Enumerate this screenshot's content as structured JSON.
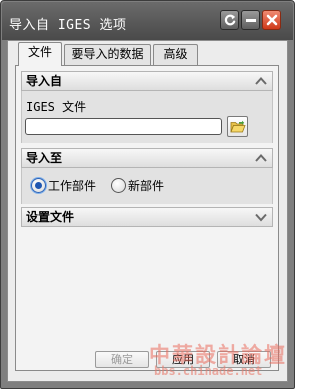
{
  "window": {
    "title": "导入自 IGES 选项"
  },
  "tabs": [
    {
      "label": "文件",
      "active": true
    },
    {
      "label": "要导入的数据",
      "active": false
    },
    {
      "label": "高级",
      "active": false
    }
  ],
  "import_from": {
    "header": "导入自",
    "field_label": "IGES 文件",
    "file_value": "",
    "placeholder": ""
  },
  "import_to": {
    "header": "导入至",
    "options": [
      {
        "label": "工作部件",
        "checked": true
      },
      {
        "label": "新部件",
        "checked": false
      }
    ]
  },
  "settings_file": {
    "header": "设置文件"
  },
  "buttons": {
    "ok": "确定",
    "apply": "应用",
    "cancel": "取消"
  },
  "watermark": {
    "main": "中華設計論壇",
    "sub": "bbs.chinade.net"
  },
  "icons": {
    "titlebar": [
      "reset-icon",
      "minimize-icon",
      "close-icon"
    ],
    "section_collapse": "chevron-up-icon",
    "section_expand": "chevron-down-icon",
    "browse": "folder-open-icon"
  },
  "colors": {
    "titlebar": "#585858",
    "close_button": "#cf3a1a",
    "radio_selected": "#1f56b0",
    "watermark": "#ea6c5c"
  }
}
